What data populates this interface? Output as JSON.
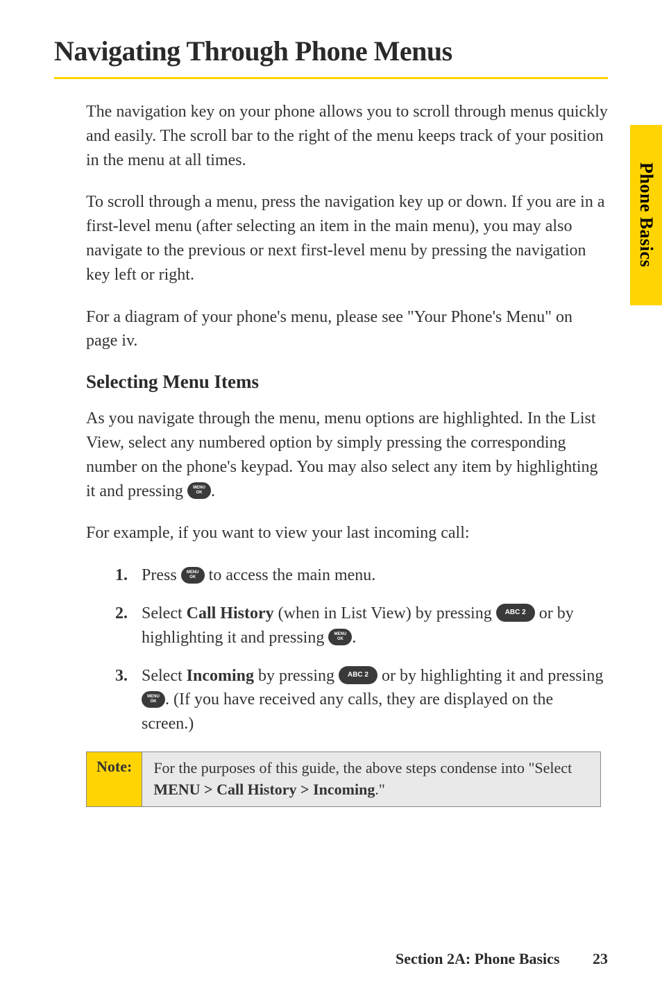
{
  "title": "Navigating Through Phone Menus",
  "para1": "The navigation key on your phone allows you to scroll through menus quickly and easily. The scroll bar to the right of the menu keeps track of your position in the menu at all times.",
  "para2": "To scroll through a menu, press the navigation key up or down. If you are in a first-level menu (after selecting an item in the main menu), you may also navigate to the previous or next first-level menu by pressing the navigation key left or right.",
  "para3": "For a diagram of your phone's menu, please see \"Your Phone's Menu\" on page iv.",
  "sub1": "Selecting Menu Items",
  "para4_a": "As you navigate through the menu, menu options are highlighted. In the List View, select any numbered option by simply pressing the corresponding number on the phone's keypad. You may also select any item by highlighting it and pressing ",
  "para4_b": ".",
  "para5": "For example, if you want to view your last incoming call:",
  "step1": {
    "num": "1.",
    "a": "Press ",
    "b": " to access the main menu."
  },
  "step2": {
    "num": "2.",
    "a": "Select ",
    "bold1": "Call History",
    "b": " (when in List View) by pressing ",
    "key1": "ABC 2",
    "c": " or by highlighting it and pressing ",
    "d": "."
  },
  "step3": {
    "num": "3.",
    "a": "Select ",
    "bold1": "Incoming",
    "b": " by pressing ",
    "key1": "ABC 2",
    "c": " or by highlighting it and pressing ",
    "d": ". (If you have received any calls, they are displayed on the screen.)"
  },
  "note": {
    "label": "Note:",
    "a": "For the purposes of this guide, the above steps condense into \"Select ",
    "bold": "MENU > Call History > Incoming",
    "b": ".\""
  },
  "sidetab": "Phone Basics",
  "footer": {
    "section": "Section 2A: Phone Basics",
    "page": "23"
  }
}
